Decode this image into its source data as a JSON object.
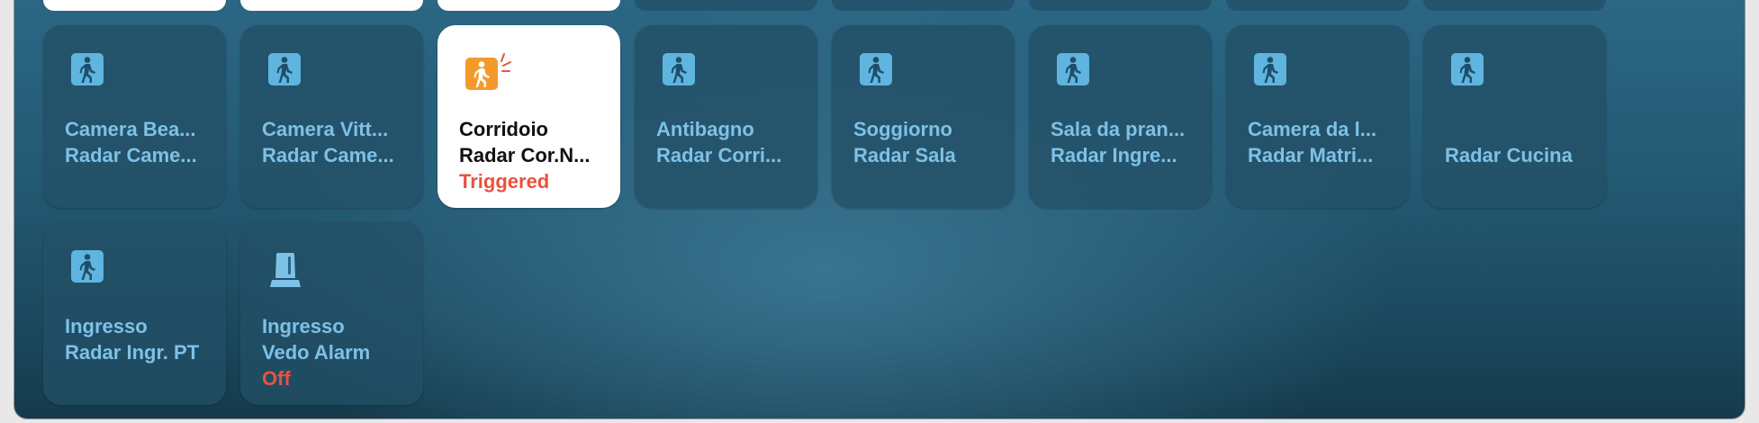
{
  "tiles": [
    {
      "name": "camera-bea",
      "room": "Camera Bea...",
      "label": "Radar Came...",
      "status": "",
      "icon": "motion-sensor-icon",
      "active": false
    },
    {
      "name": "camera-vitt",
      "room": "Camera Vitt...",
      "label": "Radar Came...",
      "status": "",
      "icon": "motion-sensor-icon",
      "active": false
    },
    {
      "name": "corridoio",
      "room": "Corridoio",
      "label": "Radar Cor.N...",
      "status": "Triggered",
      "icon": "motion-sensor-triggered-icon",
      "active": true
    },
    {
      "name": "antibagno",
      "room": "Antibagno",
      "label": "Radar Corri...",
      "status": "",
      "icon": "motion-sensor-icon",
      "active": false
    },
    {
      "name": "soggiorno",
      "room": "Soggiorno",
      "label": "Radar Sala",
      "status": "",
      "icon": "motion-sensor-icon",
      "active": false
    },
    {
      "name": "sala-da-pranzo",
      "room": "Sala da pran...",
      "label": "Radar Ingre...",
      "status": "",
      "icon": "motion-sensor-icon",
      "active": false
    },
    {
      "name": "camera-da-letto",
      "room": "Camera da l...",
      "label": "Radar Matri...",
      "status": "",
      "icon": "motion-sensor-icon",
      "active": false
    },
    {
      "name": "cucina",
      "room": "",
      "label": "Radar Cucina",
      "status": "",
      "icon": "motion-sensor-icon",
      "active": false
    },
    {
      "name": "ingresso-radar",
      "room": "Ingresso",
      "label": "Radar Ingr. PT",
      "status": "",
      "icon": "motion-sensor-icon",
      "active": false
    },
    {
      "name": "ingresso-vedo-alarm",
      "room": "Ingresso",
      "label": "Vedo Alarm",
      "status": "Off",
      "icon": "siren-icon",
      "active": false
    }
  ],
  "colors": {
    "accent_text": "#7ec1e6",
    "icon_blue": "#5fb4e0",
    "icon_orange": "#f39a2b",
    "status_red": "#e8533d",
    "tile_active_bg": "#ffffff"
  }
}
